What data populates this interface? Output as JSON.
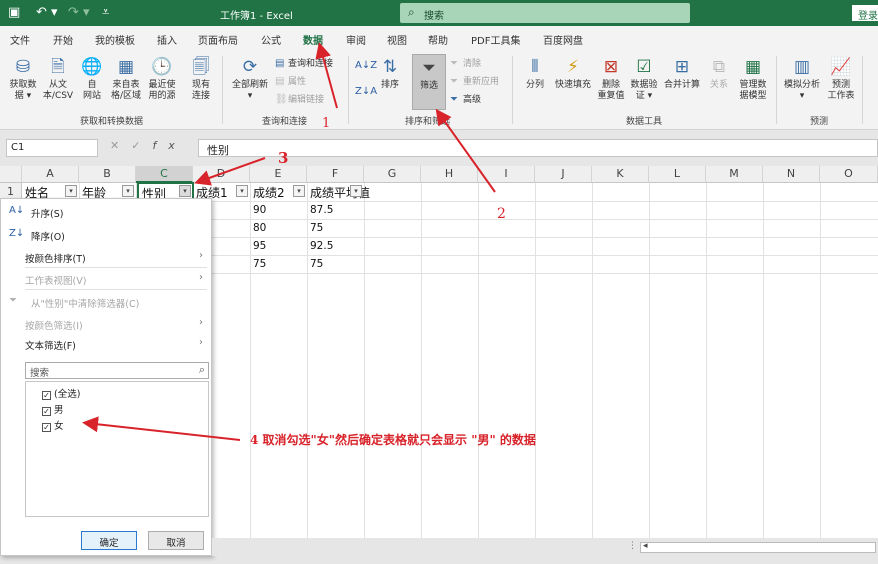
{
  "window": {
    "title": "工作簿1 - Excel",
    "search_placeholder": "搜索",
    "login": "登录"
  },
  "menu": [
    "文件",
    "开始",
    "我的模板",
    "插入",
    "页面布局",
    "公式",
    "数据",
    "审阅",
    "视图",
    "帮助",
    "PDF工具集",
    "百度网盘"
  ],
  "ribbon": {
    "get_data": [
      "获取数",
      "据 ▾"
    ],
    "from_text": [
      "从文",
      "本/CSV"
    ],
    "from_web": [
      "自",
      "网站"
    ],
    "from_table": [
      "来自表",
      "格/区域"
    ],
    "recent": [
      "最近使",
      "用的源"
    ],
    "existing": [
      "现有",
      "连接"
    ],
    "refresh_all": [
      "全部刷新",
      "▾"
    ],
    "queries_connections": "查询和连接",
    "properties": "属性",
    "edit_links": "编辑链接",
    "sort_asc": "A↓Z",
    "sort_desc": "Z↓A",
    "sort": "排序",
    "filter": "筛选",
    "clear": "清除",
    "reapply": "重新应用",
    "advanced": "高级",
    "split": "分列",
    "flash_fill": "快速填充",
    "remove_dup": [
      "删除",
      "重复值"
    ],
    "validation": [
      "数据验",
      "证 ▾"
    ],
    "consolidate": "合并计算",
    "relationships": "关系",
    "data_model": [
      "管理数",
      "据模型"
    ],
    "whatif": [
      "模拟分析",
      "▾"
    ],
    "forecast": [
      "预测",
      "工作表"
    ],
    "groups": [
      "获取和转换数据",
      "查询和连接",
      "排序和筛选",
      "数据工具",
      "预测"
    ]
  },
  "formula_bar": {
    "name_box": "C1",
    "fx": "fx",
    "cancel": "✕",
    "enter": "✓",
    "content": "性别"
  },
  "columns": [
    "A",
    "B",
    "C",
    "D",
    "E",
    "F",
    "G",
    "H",
    "I",
    "J",
    "K",
    "L",
    "M",
    "N",
    "O"
  ],
  "rows": [
    "1"
  ],
  "header_row": [
    "姓名",
    "年龄",
    "性别",
    "成绩1",
    "成绩2",
    "成绩平均值"
  ],
  "data_rows": [
    [
      "90",
      "87.5"
    ],
    [
      "80",
      "75"
    ],
    [
      "95",
      "92.5"
    ],
    [
      "75",
      "75"
    ]
  ],
  "filter_menu": {
    "sort_asc": "升序(S)",
    "sort_desc": "降序(O)",
    "sort_color": "按颜色排序(T)",
    "sheet_view": "工作表视图(V)",
    "clear_filter": "从\"性别\"中清除筛选器(C)",
    "color_filter": "按颜色筛选(I)",
    "text_filter": "文本筛选(F)",
    "search_placeholder": "搜索",
    "items": [
      "(全选)",
      "男",
      "女"
    ],
    "ok": "确定",
    "cancel": "取消"
  },
  "annotations": {
    "n1": "1",
    "n2": "2",
    "n3": "3",
    "n4": "4 取消勾选\"女\"然后确定表格就只会显示 \"男\" 的数据",
    "color": "#d8232a"
  }
}
